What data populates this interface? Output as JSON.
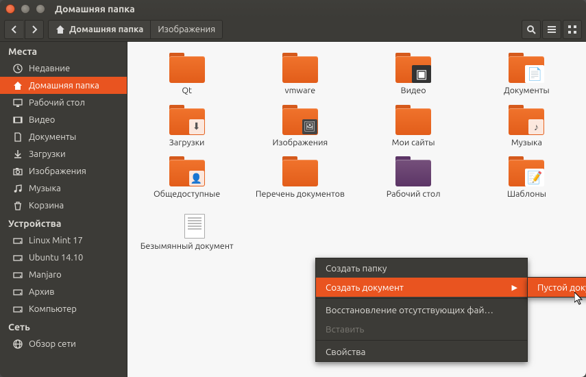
{
  "window": {
    "title": "Домашняя папка"
  },
  "breadcrumb": {
    "home": "Домашняя папка",
    "second": "Изображения"
  },
  "sidebar": {
    "groups": [
      {
        "header": "Места",
        "items": [
          {
            "label": "Недавние",
            "icon": "clock"
          },
          {
            "label": "Домашняя папка",
            "icon": "home",
            "active": true
          },
          {
            "label": "Рабочий стол",
            "icon": "desktop"
          },
          {
            "label": "Видео",
            "icon": "video"
          },
          {
            "label": "Документы",
            "icon": "doc"
          },
          {
            "label": "Загрузки",
            "icon": "download"
          },
          {
            "label": "Изображения",
            "icon": "camera"
          },
          {
            "label": "Музыка",
            "icon": "music"
          },
          {
            "label": "Корзина",
            "icon": "trash"
          }
        ]
      },
      {
        "header": "Устройства",
        "items": [
          {
            "label": "Linux Mint 17",
            "icon": "drive"
          },
          {
            "label": "Ubuntu 14.10",
            "icon": "drive"
          },
          {
            "label": "Manjaro",
            "icon": "drive"
          },
          {
            "label": "Архив",
            "icon": "drive"
          },
          {
            "label": "Компьютер",
            "icon": "drive"
          }
        ]
      },
      {
        "header": "Сеть",
        "items": [
          {
            "label": "Обзор сети",
            "icon": "network"
          }
        ]
      }
    ]
  },
  "items": [
    {
      "label": "Qt",
      "type": "folder"
    },
    {
      "label": "vmware",
      "type": "folder"
    },
    {
      "label": "Видео",
      "type": "folder",
      "emblem": "video"
    },
    {
      "label": "Документы",
      "type": "folder",
      "emblem": "doc-paper"
    },
    {
      "label": "Загрузки",
      "type": "folder",
      "emblem": "download"
    },
    {
      "label": "Изображения",
      "type": "folder",
      "emblem": "image"
    },
    {
      "label": "Мои сайты",
      "type": "folder"
    },
    {
      "label": "Музыка",
      "type": "folder",
      "emblem": "music"
    },
    {
      "label": "Общедоступные",
      "type": "folder",
      "emblem": "share"
    },
    {
      "label": "Перечень документов",
      "type": "folder"
    },
    {
      "label": "Рабочий стол",
      "type": "folder",
      "variant": "purple"
    },
    {
      "label": "Шаблоны",
      "type": "folder",
      "emblem": "template"
    },
    {
      "label": "Безымянный документ",
      "type": "doc"
    }
  ],
  "ctx": [
    {
      "label": "Создать папку",
      "kind": "item"
    },
    {
      "label": "Создать документ",
      "kind": "submenu",
      "hover": true
    },
    {
      "kind": "sep"
    },
    {
      "label": "Восстановление отсутствующих фай…",
      "kind": "item"
    },
    {
      "label": "Вставить",
      "kind": "item",
      "disabled": true
    },
    {
      "kind": "sep"
    },
    {
      "label": "Свойства",
      "kind": "item"
    }
  ],
  "submenu": [
    {
      "label": "Пустой документ",
      "hover": true
    }
  ]
}
